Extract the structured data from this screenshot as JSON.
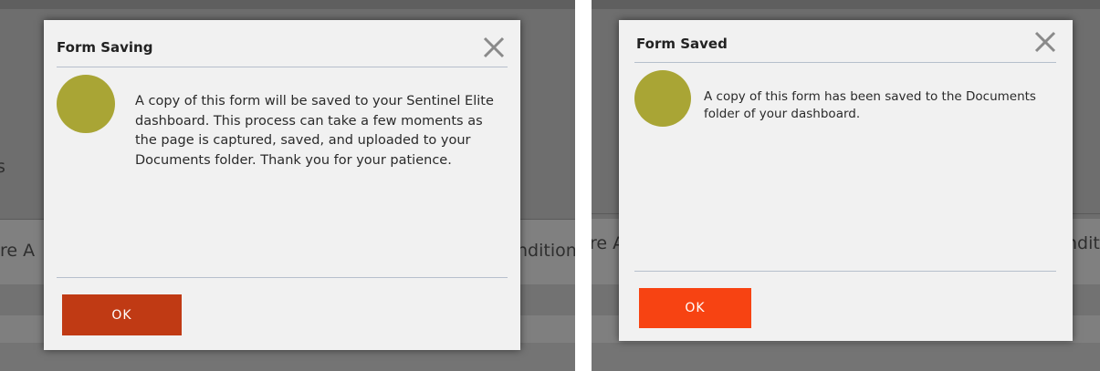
{
  "colors": {
    "ok_left": "#c03a14",
    "ok_right": "#f74312",
    "avatar": "#a9a535",
    "separator": "#b6bfcc",
    "dialog_bg": "#f1f1f1"
  },
  "left": {
    "background": {
      "side_fragment": "s",
      "row_left_fragment": "re A",
      "row_right_fragment": "ndition"
    },
    "dialog": {
      "title": "Form Saving",
      "close_icon": "close-icon",
      "message": "A copy of this form will be saved to your Sentinel Elite dashboard. This process can take a few moments as the page is captured, saved, and uploaded to your Documents folder. Thank you for your patience.",
      "ok_label": "OK"
    }
  },
  "right": {
    "background": {
      "row_left_fragment": "re A",
      "row_right_fragment": "ndit"
    },
    "dialog": {
      "title": "Form Saved",
      "close_icon": "close-icon",
      "message": "A copy of this form has been saved to the Documents folder of your dashboard.",
      "ok_label": "OK"
    }
  }
}
